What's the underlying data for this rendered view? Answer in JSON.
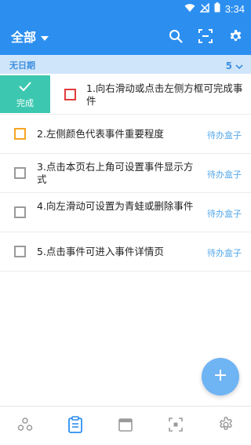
{
  "status_bar": {
    "time": "3:34",
    "icons": [
      "wifi-icon",
      "cellular-off-icon",
      "battery-icon"
    ]
  },
  "app_bar": {
    "title": "全部",
    "icons": [
      "search-icon",
      "scan-icon",
      "settings-icon"
    ]
  },
  "group": {
    "label": "无日期",
    "count": "5"
  },
  "swipe_action": {
    "label": "完成"
  },
  "tasks": [
    {
      "text": "1.向右滑动或点击左侧方框可完成事件",
      "priority_color": "#e23b3b",
      "category": ""
    },
    {
      "text": "2.左侧颜色代表事件重要程度",
      "priority_color": "#f5a623",
      "category": "待办盒子"
    },
    {
      "text": "3.点击本页右上角可设置事件显示方式",
      "priority_color": "#9a9a9a",
      "category": "待办盒子"
    },
    {
      "text": "4.向左滑动可设置为青蛙或删除事件",
      "priority_color": "#9a9a9a",
      "category": "待办盒子"
    },
    {
      "text": "5.点击事件可进入事件详情页",
      "priority_color": "#9a9a9a",
      "category": "待办盒子"
    }
  ],
  "fab": {
    "icon": "plus-icon"
  },
  "bottom_nav": [
    {
      "name": "circles-icon",
      "active": false
    },
    {
      "name": "clipboard-icon",
      "active": true
    },
    {
      "name": "calendar-icon",
      "active": false
    },
    {
      "name": "focus-icon",
      "active": false
    },
    {
      "name": "settings-icon",
      "active": false
    }
  ],
  "colors": {
    "primary": "#2c8ff0",
    "group_header_bg": "#cfe5fa",
    "swipe_complete": "#3cc8b0",
    "category_text": "#55a8ea",
    "fab": "#6fb4f3",
    "nav_active": "#2c8ff0",
    "nav_inactive": "#9a9a9a"
  }
}
